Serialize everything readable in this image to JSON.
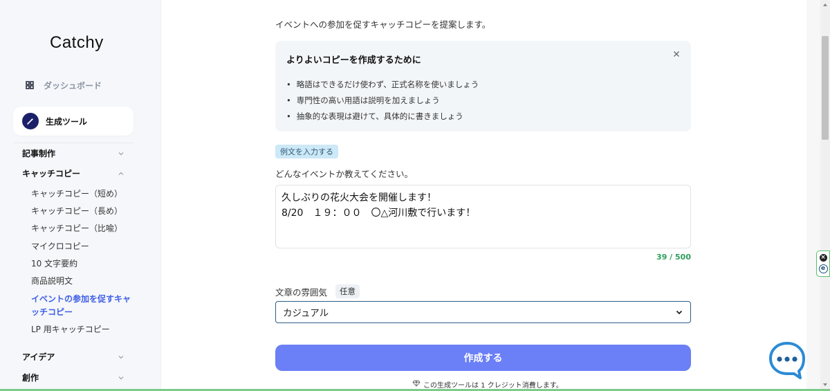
{
  "app": {
    "name": "Catchy"
  },
  "sidebar": {
    "dashboard_label": "ダッシュボード",
    "gen_tools_label": "生成ツール",
    "categories": [
      {
        "label": "記事制作",
        "expanded": false
      },
      {
        "label": "キャッチコピー",
        "expanded": true
      },
      {
        "label": "アイデア",
        "expanded": false
      },
      {
        "label": "創作",
        "expanded": false
      }
    ],
    "subitems": [
      "キャッチコピー（短め）",
      "キャッチコピー（長め）",
      "キャッチコピー（比喩）",
      "マイクロコピー",
      "10 文字要約",
      "商品説明文",
      "イベントの参加を促すキャッチコピー",
      "LP 用キャッチコピー"
    ],
    "active_subitem": "イベントの参加を促すキャッチコピー"
  },
  "main": {
    "intro": "イベントへの参加を促すキャッチコピーを提案します。",
    "tips": {
      "title": "よりよいコピーを作成するために",
      "items": [
        "略語はできるだけ使わず、正式名称を使いましょう",
        "専門性の高い用語は説明を加えましょう",
        "抽象的な表現は避けて、具体的に書きましょう"
      ]
    },
    "example_button": "例文を入力する",
    "question_label": "どんなイベントか教えてください。",
    "input_value": "久しぶりの花火大会を開催します！\n8/20　１９：００　〇△河川敷で行います！",
    "char_count": "39 / 500",
    "tone_label": "文章の雰囲気",
    "optional_badge": "任意",
    "tone_selected": "カジュアル",
    "submit_label": "作成する",
    "credit_note": "この生成ツールは 1 クレジット消費します。"
  },
  "colors": {
    "primary_button": "#6b7ff6",
    "active_link": "#3f5ee6",
    "counter": "#2e9e5b",
    "gen_tools_icon_bg": "#1a2068",
    "chat_icon": "#2b8bd6"
  }
}
